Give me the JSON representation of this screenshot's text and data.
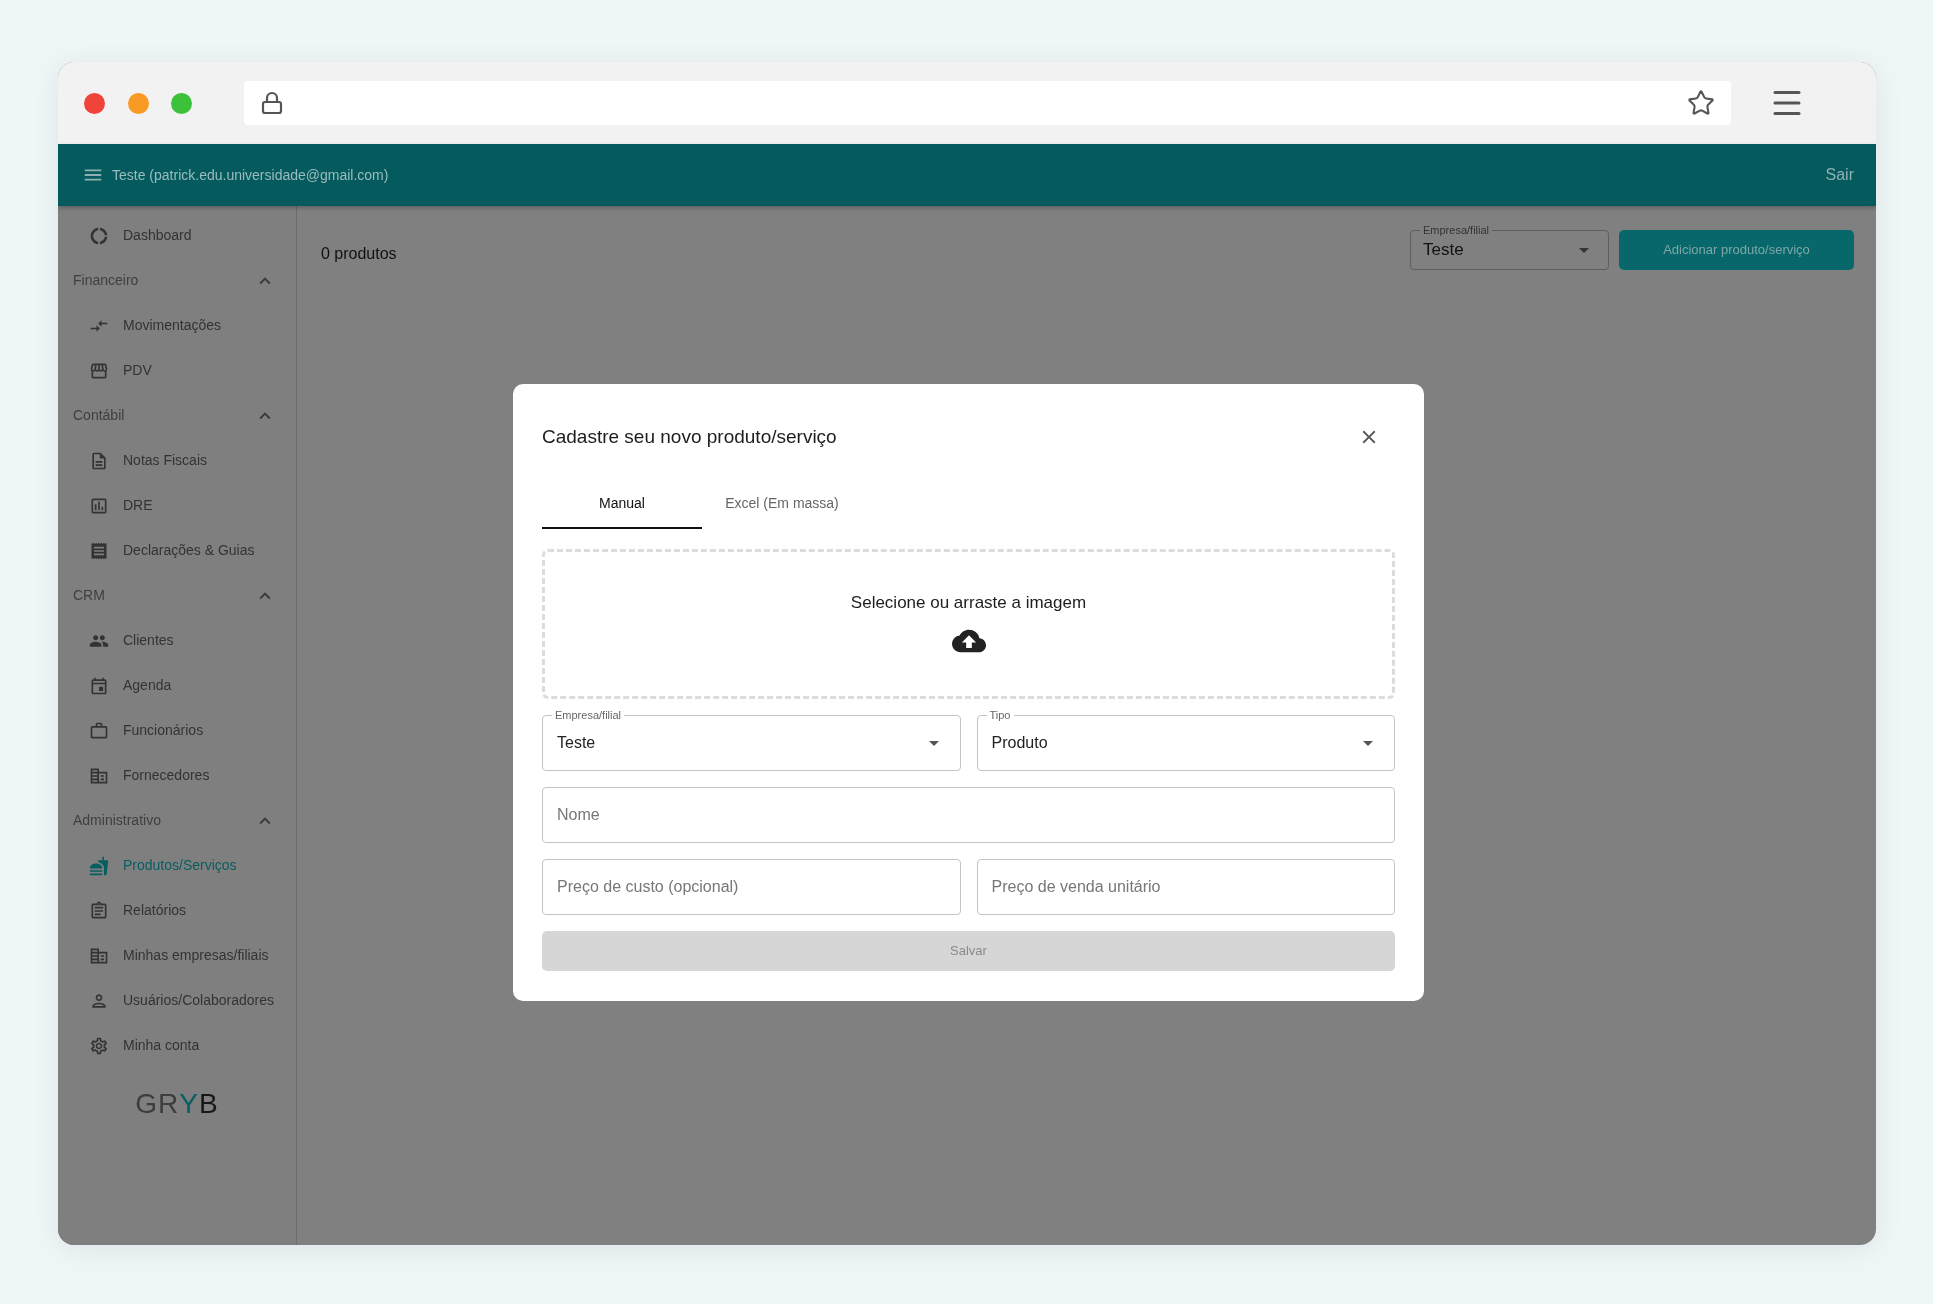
{
  "header": {
    "user": "Teste (patrick.edu.universidade@gmail.com)",
    "logout": "Sair"
  },
  "sidebar": {
    "groups": [
      {
        "items": [
          {
            "label": "Dashboard",
            "selected": false
          }
        ]
      },
      {
        "title": "Financeiro",
        "expanded": true,
        "items": [
          {
            "label": "Movimentações",
            "selected": false
          },
          {
            "label": "PDV",
            "selected": false
          }
        ]
      },
      {
        "title": "Contábil",
        "expanded": true,
        "items": [
          {
            "label": "Notas Fiscais",
            "selected": false
          },
          {
            "label": "DRE",
            "selected": false
          },
          {
            "label": "Declarações & Guias",
            "selected": false
          }
        ]
      },
      {
        "title": "CRM",
        "expanded": true,
        "items": [
          {
            "label": "Clientes",
            "selected": false
          },
          {
            "label": "Agenda",
            "selected": false
          },
          {
            "label": "Funcionários",
            "selected": false
          },
          {
            "label": "Fornecedores",
            "selected": false
          }
        ]
      },
      {
        "title": "Administrativo",
        "expanded": true,
        "items": [
          {
            "label": "Produtos/Serviços",
            "selected": true
          },
          {
            "label": "Relatórios",
            "selected": false
          },
          {
            "label": "Minhas empresas/filiais",
            "selected": false
          },
          {
            "label": "Usuários/Colaboradores",
            "selected": false
          },
          {
            "label": "Minha conta",
            "selected": false
          }
        ]
      }
    ],
    "logo": [
      {
        "text": "GR",
        "color": "#3d3d3d"
      },
      {
        "text": "Y",
        "color": "#0a5f62"
      },
      {
        "text": "B",
        "color": "#161616"
      }
    ]
  },
  "main": {
    "count": "0 produtos",
    "company_select": {
      "label": "Empresa/filial",
      "value": "Teste"
    },
    "add_button": "Adicionar produto/serviço"
  },
  "modal": {
    "title": "Cadastre seu novo produto/serviço",
    "tabs": [
      {
        "label": "Manual",
        "selected": true
      },
      {
        "label": "Excel (Em massa)",
        "selected": false
      }
    ],
    "dropzone": "Selecione ou arraste a imagem",
    "company_select": {
      "label": "Empresa/filial",
      "value": "Teste"
    },
    "type_select": {
      "label": "Tipo",
      "value": "Produto"
    },
    "name_field": {
      "placeholder": "Nome"
    },
    "cost_field": {
      "placeholder": "Preço de custo (opcional)"
    },
    "price_field": {
      "placeholder": "Preço de venda unitário"
    },
    "save_button": {
      "label": "Salvar",
      "disabled": true
    }
  }
}
